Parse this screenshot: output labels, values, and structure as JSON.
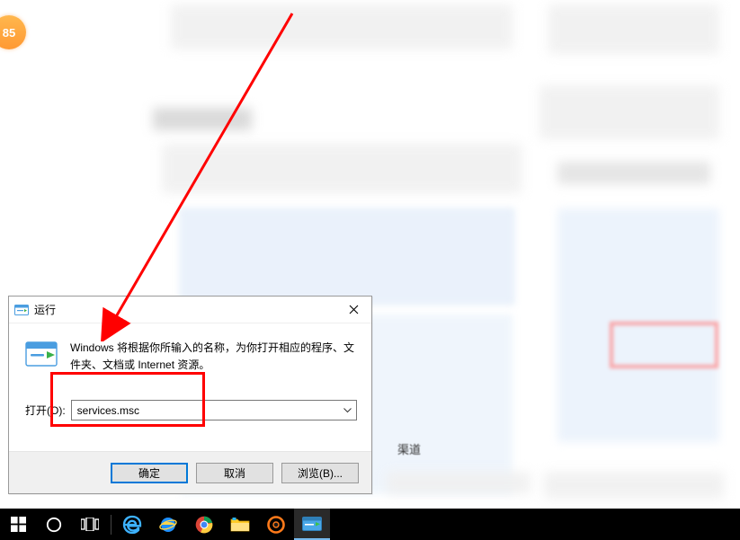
{
  "badge": {
    "text": "85"
  },
  "run_dialog": {
    "title": "运行",
    "description": "Windows 将根据你所输入的名称，为你打开相应的程序、文件夹、文档或 Internet 资源。",
    "field_label": "打开(O):",
    "field_value": "services.msc",
    "buttons": {
      "ok": "确定",
      "cancel": "取消",
      "browse": "浏览(B)..."
    }
  },
  "blur_text": {
    "channel": "渠道"
  },
  "icons": {
    "run": "run-icon",
    "close": "close-icon",
    "dropdown": "chevron-down-icon",
    "start": "windows-start-icon",
    "cortana": "cortana-circle-icon",
    "taskview": "task-view-icon",
    "edge": "edge-icon",
    "ie": "ie-icon",
    "chrome": "chrome-icon",
    "explorer": "file-explorer-icon",
    "app_orange": "app-orange-icon",
    "app_light": "app-light-icon"
  }
}
